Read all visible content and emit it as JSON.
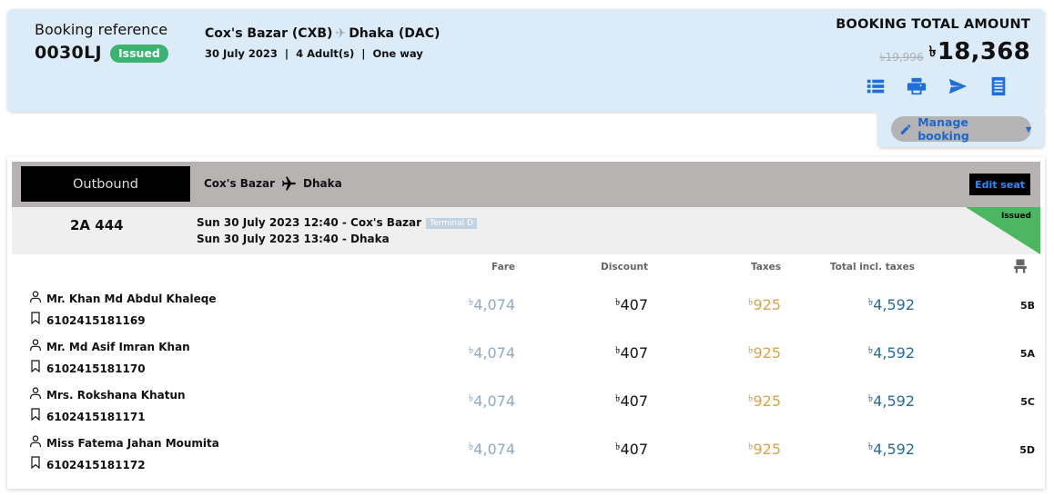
{
  "booking": {
    "ref_label": "Booking reference",
    "ref_code": "0030LJ",
    "status": "Issued",
    "origin": "Cox's Bazar (CXB)",
    "destination": "Dhaka (DAC)",
    "trip_meta": "30 July 2023  |  4 Adult(s)  |  One way",
    "total_label": "BOOKING TOTAL AMOUNT",
    "old_price": "৳19,996",
    "currency": "৳",
    "price": "18,368",
    "icons": [
      "list-icon",
      "print-icon",
      "send-icon",
      "receipt-icon"
    ],
    "manage_label": "Manage booking"
  },
  "segment": {
    "direction": "Outbound",
    "from": "Cox's Bazar",
    "to": "Dhaka",
    "edit_seat": "Edit seat",
    "flight_no": "2A 444",
    "leg1": "Sun 30 July 2023 12:40 - Cox's Bazar",
    "terminal": "Terminal D",
    "leg2": "Sun 30 July 2023 13:40 - Dhaka",
    "status": "Issued"
  },
  "columns": {
    "fare": "Fare",
    "discount": "Discount",
    "taxes": "Taxes",
    "total": "Total incl. taxes"
  },
  "passengers": [
    {
      "name": "Mr. Khan Md Abdul Khaleqe",
      "ticket": "6102415181169",
      "fare": "4,074",
      "discount": "407",
      "taxes": "925",
      "total": "4,592",
      "seat": "5B"
    },
    {
      "name": "Mr. Md Asif Imran Khan",
      "ticket": "6102415181170",
      "fare": "4,074",
      "discount": "407",
      "taxes": "925",
      "total": "4,592",
      "seat": "5A"
    },
    {
      "name": "Mrs. Rokshana Khatun",
      "ticket": "6102415181171",
      "fare": "4,074",
      "discount": "407",
      "taxes": "925",
      "total": "4,592",
      "seat": "5C"
    },
    {
      "name": "Miss Fatema Jahan Moumita",
      "ticket": "6102415181172",
      "fare": "4,074",
      "discount": "407",
      "taxes": "925",
      "total": "4,592",
      "seat": "5D"
    }
  ],
  "colors": {
    "header_bg": "#dcebf8",
    "issued_green": "#3cb371",
    "accent_blue": "#1e6fd9",
    "fare": "#8daac2",
    "taxes": "#d9a34a",
    "total": "#2a6a98"
  }
}
